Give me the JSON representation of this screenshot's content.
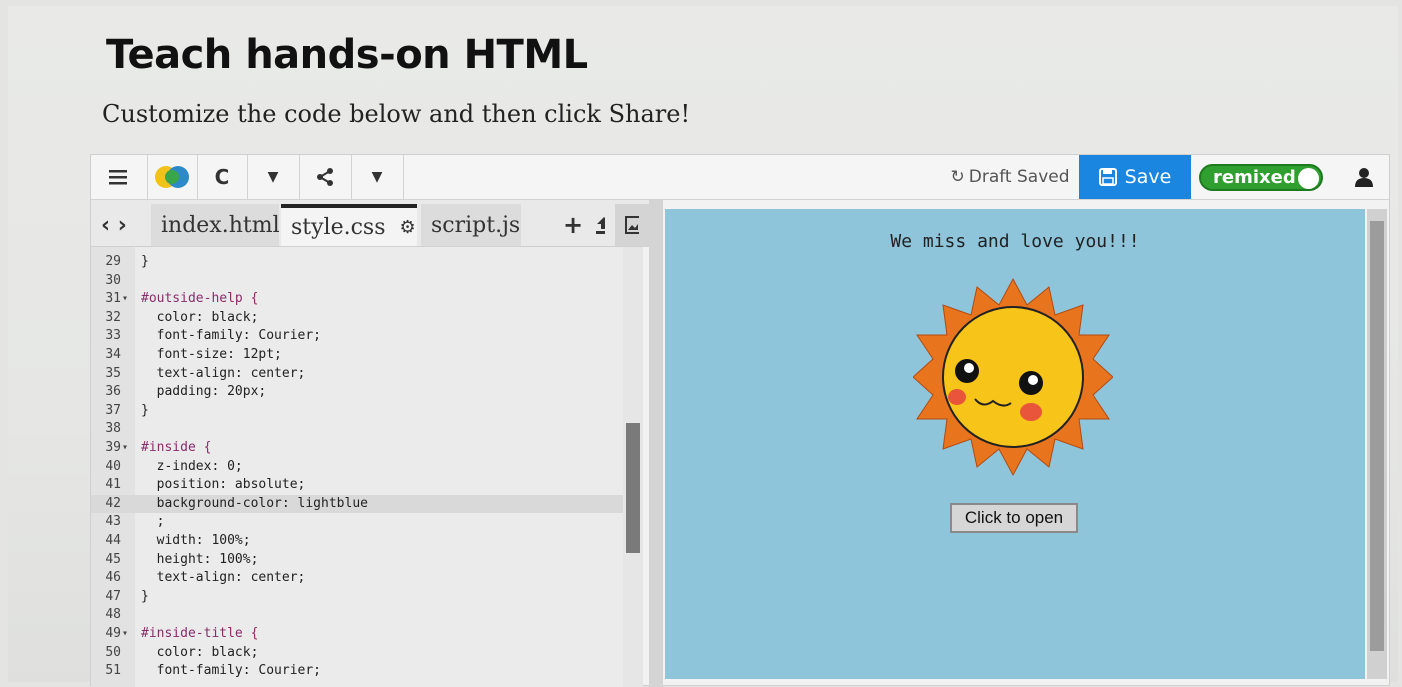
{
  "page": {
    "title": "Teach hands-on HTML",
    "subtitle": "Customize the code below and then click Share!"
  },
  "toolbar": {
    "draft_status": "Draft Saved",
    "save_label": "Save",
    "remix_label": "remixed"
  },
  "tabs": [
    {
      "label": "index.html",
      "active": false
    },
    {
      "label": "style.css",
      "active": true
    },
    {
      "label": "script.js",
      "active": false
    }
  ],
  "code_lines": [
    {
      "num": "29",
      "text": "}"
    },
    {
      "num": "30",
      "text": ""
    },
    {
      "num": "31",
      "text": "#outside-help {",
      "fold": true
    },
    {
      "num": "32",
      "text": "  color: black;"
    },
    {
      "num": "33",
      "text": "  font-family: Courier;"
    },
    {
      "num": "34",
      "text": "  font-size: 12pt;"
    },
    {
      "num": "35",
      "text": "  text-align: center;"
    },
    {
      "num": "36",
      "text": "  padding: 20px;"
    },
    {
      "num": "37",
      "text": "}"
    },
    {
      "num": "38",
      "text": ""
    },
    {
      "num": "39",
      "text": "#inside {",
      "fold": true
    },
    {
      "num": "40",
      "text": "  z-index: 0;"
    },
    {
      "num": "41",
      "text": "  position: absolute;"
    },
    {
      "num": "42",
      "text": "  background-color: lightblue",
      "active": true
    },
    {
      "num": "43",
      "text": "  ;"
    },
    {
      "num": "44",
      "text": "  width: 100%;"
    },
    {
      "num": "45",
      "text": "  height: 100%;"
    },
    {
      "num": "46",
      "text": "  text-align: center;"
    },
    {
      "num": "47",
      "text": "}"
    },
    {
      "num": "48",
      "text": ""
    },
    {
      "num": "49",
      "text": "#inside-title {",
      "fold": true
    },
    {
      "num": "50",
      "text": "  color: black;"
    },
    {
      "num": "51",
      "text": "  font-family: Courier;"
    }
  ],
  "preview": {
    "heading": "We miss and love you!!!",
    "button_label": "Click to open",
    "background": "#8ec5db"
  },
  "colors": {
    "save": "#1a86e0",
    "remixed": "#2f9f2f",
    "sun_rays": "#e8741e",
    "sun_face": "#f7c41a",
    "cheeks": "#e8553a"
  },
  "icons": [
    "menu-icon",
    "logo-icon",
    "refresh-icon",
    "chevron-down-icon",
    "share-icon",
    "code-toggle-icon",
    "gear-icon",
    "add-file-icon",
    "upload-icon",
    "image-icon",
    "user-icon"
  ]
}
